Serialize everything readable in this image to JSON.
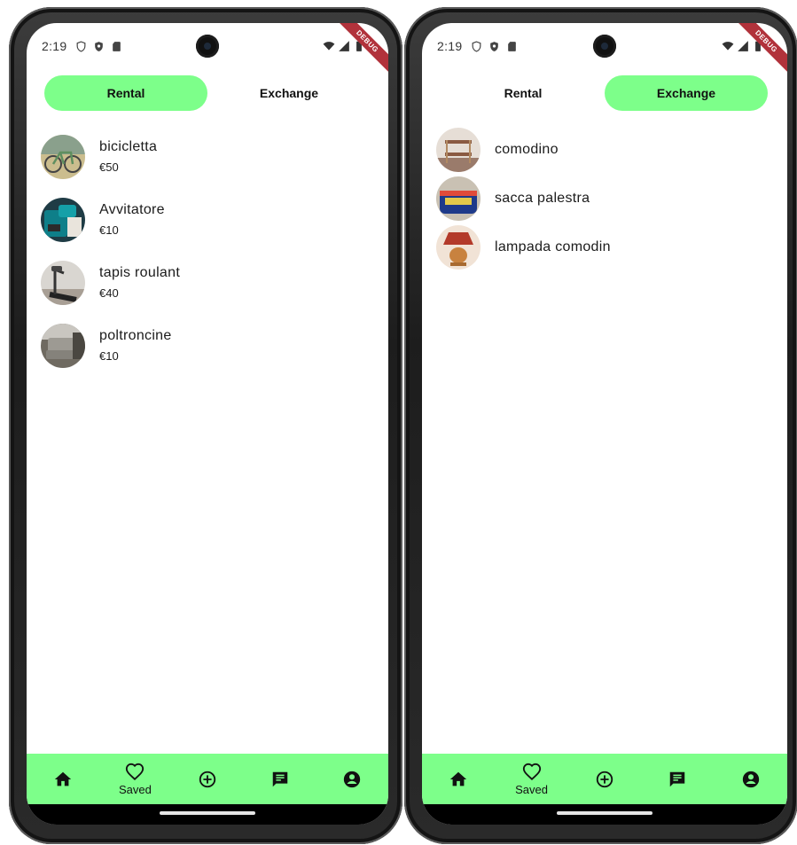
{
  "status": {
    "time": "2:19"
  },
  "debug_label": "DEBUG",
  "tabs": {
    "rental": "Rental",
    "exchange": "Exchange"
  },
  "rental_items": [
    {
      "title": "bicicletta",
      "price": "€50",
      "thumb": "bicycle-photo"
    },
    {
      "title": "Avvitatore",
      "price": "€10",
      "thumb": "screwdriver-photo"
    },
    {
      "title": "tapis roulant",
      "price": "€40",
      "thumb": "treadmill-photo"
    },
    {
      "title": "poltroncine",
      "price": "€10",
      "thumb": "armchair-photo"
    }
  ],
  "exchange_items": [
    {
      "title": "comodino",
      "thumb": "nightstand-photo"
    },
    {
      "title": "sacca palestra",
      "thumb": "gym-bag-photo"
    },
    {
      "title": "lampada comodin",
      "thumb": "lamp-photo"
    }
  ],
  "bottom_nav": {
    "items": [
      {
        "icon": "home-icon",
        "label": ""
      },
      {
        "icon": "heart-outline-icon",
        "label": "Saved"
      },
      {
        "icon": "add-circle-icon",
        "label": ""
      },
      {
        "icon": "chat-icon",
        "label": ""
      },
      {
        "icon": "account-circle-icon",
        "label": ""
      }
    ]
  },
  "colors": {
    "accent": "#7dff8a",
    "debug_banner": "#b1323b",
    "text": "#1b1b1b"
  }
}
